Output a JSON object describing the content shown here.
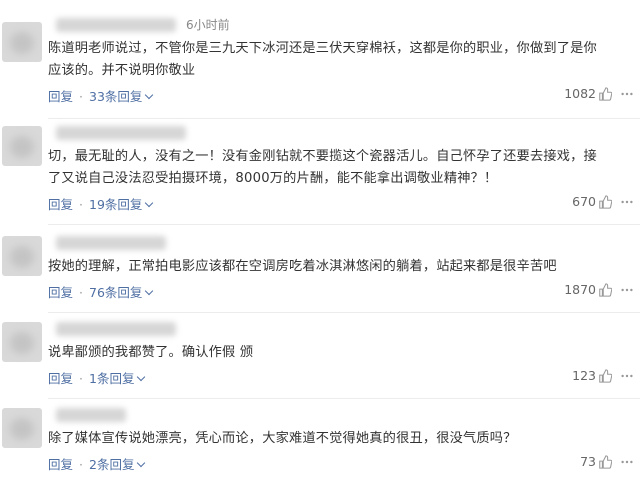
{
  "comments": [
    {
      "time": "6小时前",
      "text": "陈道明老师说过，不管你是三九天下冰河还是三伏天穿棉袄，这都是你的职业，你做到了是你应该的。并不说明你敬业",
      "reply_label": "回复",
      "replies_label": "33条回复",
      "likes": "1082"
    },
    {
      "time": "",
      "text": "切，最无耻的人，没有之一！没有金刚钻就不要揽这个瓷器活儿。自己怀孕了还要去接戏，接了又说自己没法忍受拍摄环境，8000万的片酬，能不能拿出调敬业精神？！",
      "reply_label": "回复",
      "replies_label": "19条回复",
      "likes": "670"
    },
    {
      "time": "",
      "text": "按她的理解，正常拍电影应该都在空调房吃着冰淇淋悠闲的躺着，站起来都是很辛苦吧",
      "reply_label": "回复",
      "replies_label": "76条回复",
      "likes": "1870"
    },
    {
      "time": "",
      "text": "说卑鄙颁的我都赞了。确认作假 颁",
      "reply_label": "回复",
      "replies_label": "1条回复",
      "likes": "123"
    },
    {
      "time": "",
      "text": "除了媒体宣传说她漂亮，凭心而论，大家难道不觉得她真的很丑，很没气质吗？",
      "reply_label": "回复",
      "replies_label": "2条回复",
      "likes": "73"
    }
  ],
  "icons": {
    "like": "thumbs-up-icon",
    "more": "more-icon",
    "expand": "chevron-down-icon"
  },
  "colors": {
    "link": "#4f6fa3",
    "text": "#333333",
    "muted": "#888888"
  }
}
